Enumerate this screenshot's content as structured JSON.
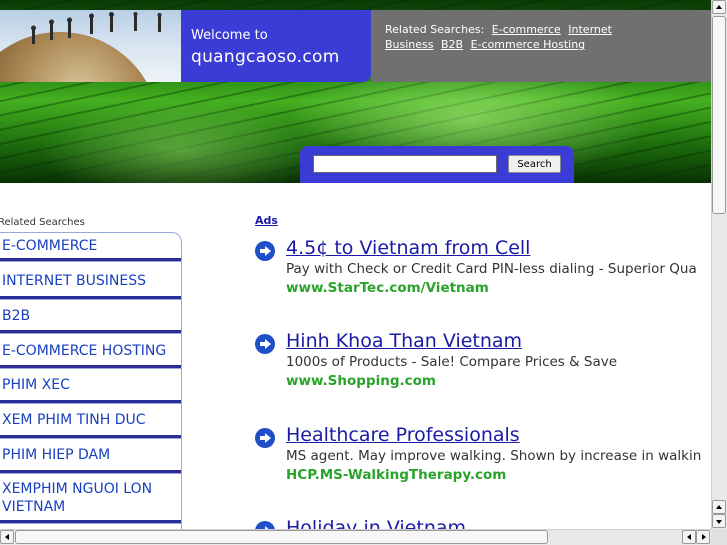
{
  "header": {
    "welcome_line1": "Welcome to",
    "site_name": "quangcaoso.com",
    "related_label": "Related Searches:",
    "related_links": [
      "E-commerce",
      "Internet",
      "Business",
      "B2B",
      "E-commerce Hosting"
    ]
  },
  "search": {
    "input_value": "",
    "button_label": "Search"
  },
  "sidebar": {
    "heading": "Related Searches",
    "items": [
      {
        "label": "E-COMMERCE"
      },
      {
        "label": "INTERNET BUSINESS"
      },
      {
        "label": "B2B"
      },
      {
        "label": "E-COMMERCE HOSTING"
      },
      {
        "label": "PHIM XEC"
      },
      {
        "label": "XEM PHIM TINH DUC"
      },
      {
        "label": "PHIM HIEP DAM"
      },
      {
        "label": "XEMPHIM NGUOI LON VIETNAM"
      }
    ]
  },
  "ads": {
    "label": "Ads",
    "items": [
      {
        "title": "4.5¢ to Vietnam from Cell",
        "description": "Pay with Check or Credit Card PIN-less dialing - Superior Qua",
        "url": "www.StarTec.com/Vietnam"
      },
      {
        "title": "Hinh Khoa Than Vietnam",
        "description": "1000s of Products - Sale! Compare Prices & Save",
        "url": "www.Shopping.com"
      },
      {
        "title": "Healthcare Professionals",
        "description": "MS agent. May improve walking. Shown by increase in walkin",
        "url": "HCP.MS-WalkingTherapy.com"
      },
      {
        "title": "Holiday in Vietnam",
        "description": "",
        "url": ""
      }
    ]
  },
  "colors": {
    "accent_blue": "#3b3bd6",
    "link_blue": "#1a1aa6",
    "url_green": "#29a329",
    "related_gray": "#707070"
  }
}
